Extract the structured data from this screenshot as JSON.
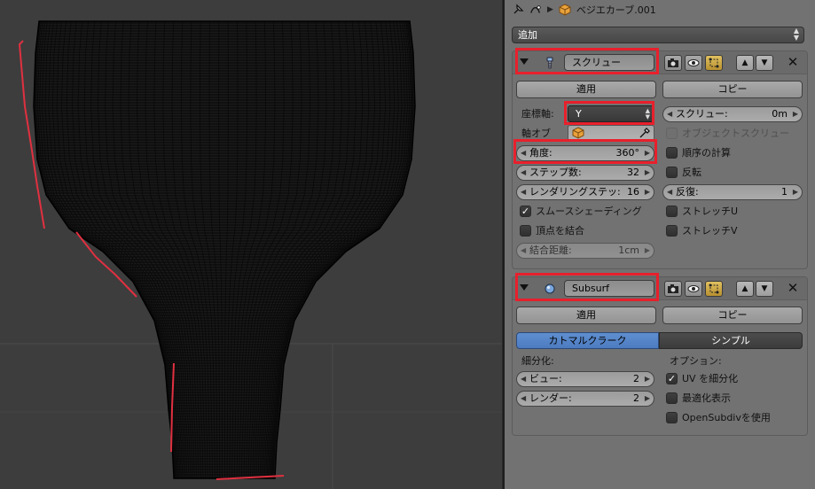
{
  "header": {
    "object_name": "ベジエカーブ.001",
    "icons": [
      "pin-icon",
      "curve-data-icon",
      "breadcrumb-arrow-icon",
      "curve-object-icon"
    ]
  },
  "add_menu": {
    "label": "追加"
  },
  "screw": {
    "name": "スクリュー",
    "icon": "screw-modifier-icon",
    "apply": "適用",
    "copy": "コピー",
    "axis_label": "座標軸:",
    "axis_value": "Y",
    "axis_object_label": "軸オブ",
    "angle": {
      "label": "角度:",
      "value": "360°"
    },
    "steps": {
      "label": "ステップ数:",
      "value": "32"
    },
    "render_steps": {
      "label": "レンダリングステッ:",
      "value": "16"
    },
    "smooth_shading": {
      "label": "スムースシェーディング",
      "checked": true
    },
    "merge_vertices": {
      "label": "頂点を結合",
      "checked": false
    },
    "merge_distance": {
      "label": "結合距離:",
      "value": "1cm"
    },
    "screw_offset": {
      "label": "スクリュー:",
      "value": "0m"
    },
    "object_screw": {
      "label": "オブジェクトスクリュー",
      "checked": false
    },
    "calc_order": {
      "label": "順序の計算",
      "checked": false
    },
    "flip": {
      "label": "反転",
      "checked": false
    },
    "iterations": {
      "label": "反復:",
      "value": "1"
    },
    "stretch_u": {
      "label": "ストレッチU",
      "checked": false
    },
    "stretch_v": {
      "label": "ストレッチV",
      "checked": false
    }
  },
  "subsurf": {
    "name": "Subsurf",
    "icon": "subsurf-modifier-icon",
    "apply": "適用",
    "copy": "コピー",
    "mode_catmull": "カトマルクラーク",
    "mode_simple": "シンプル",
    "subdivisions_label": "細分化:",
    "view": {
      "label": "ビュー:",
      "value": "2"
    },
    "render": {
      "label": "レンダー:",
      "value": "2"
    },
    "options_label": "オプション:",
    "subdivide_uvs": {
      "label": "UV を細分化",
      "checked": true
    },
    "optimal_display": {
      "label": "最適化表示",
      "checked": false
    },
    "use_opensubdiv": {
      "label": "OpenSubdivを使用",
      "checked": false
    }
  },
  "colors": {
    "highlight": "#e8202c",
    "active_segment": "#5f8fd0",
    "panel": "#727272",
    "viewport": "#3d3d3d",
    "mesh": "#111111",
    "curve": "#e03040"
  }
}
